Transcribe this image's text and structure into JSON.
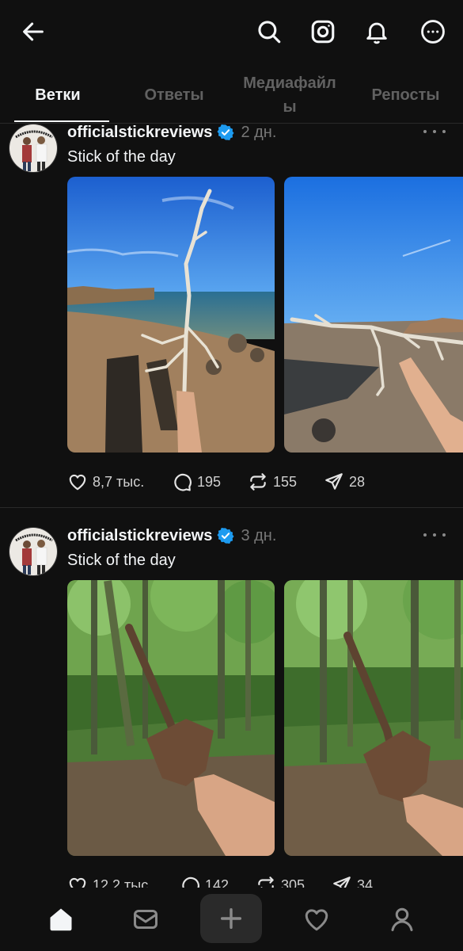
{
  "header": {
    "back_icon": "arrow-left-icon",
    "actions": [
      "search-icon",
      "instagram-icon",
      "bell-icon",
      "more-circle-icon"
    ]
  },
  "tabs": [
    {
      "label": "Ветки",
      "active": true
    },
    {
      "label": "Ответы",
      "active": false
    },
    {
      "label": "Медиафайлы",
      "active": false
    },
    {
      "label": "Репосты",
      "active": false
    }
  ],
  "posts": [
    {
      "username": "officialstickreviews",
      "verified": true,
      "time": "2 дн.",
      "text": "Stick of the day",
      "likes": "8,7 тыс.",
      "replies": "195",
      "reposts": "155",
      "shares": "28"
    },
    {
      "username": "officialstickreviews",
      "verified": true,
      "time": "3 дн.",
      "text": "Stick of the day",
      "likes": "12,2 тыс.",
      "replies": "142",
      "reposts": "305",
      "shares": "34"
    }
  ],
  "avatar_text": "official stick reviews",
  "colors": {
    "background": "#101010",
    "text": "#f3f5f7",
    "muted": "#777777",
    "verified": "#1d9bf0"
  },
  "bottom_nav": [
    "home-icon",
    "inbox-icon",
    "plus-icon",
    "heart-icon",
    "profile-icon"
  ]
}
